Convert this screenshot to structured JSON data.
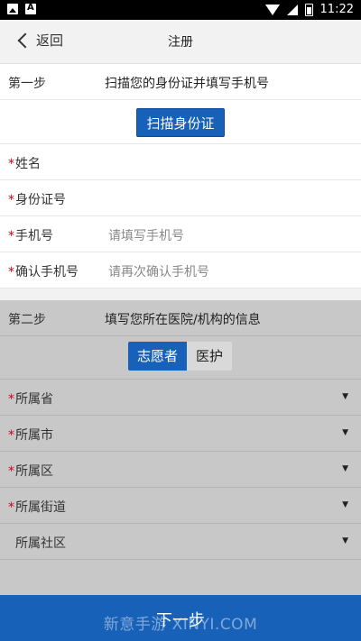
{
  "statusbar": {
    "time": "11:22"
  },
  "nav": {
    "back_label": "返回",
    "title": "注册"
  },
  "step1": {
    "step_label": "第一步",
    "description": "扫描您的身份证并填写手机号",
    "scan_button": "扫描身份证",
    "fields": [
      {
        "label": "姓名",
        "required": "*",
        "value": ""
      },
      {
        "label": "身份证号",
        "required": "*",
        "value": ""
      },
      {
        "label": "手机号",
        "required": "*",
        "placeholder": "请填写手机号"
      },
      {
        "label": "确认手机号",
        "required": "*",
        "placeholder": "请再次确认手机号"
      }
    ]
  },
  "step2": {
    "step_label": "第二步",
    "description": "填写您所在医院/机构的信息",
    "segment": {
      "options": [
        "志愿者",
        "医护"
      ],
      "selected": "志愿者"
    },
    "selects": [
      {
        "label": "所属省",
        "required": "*"
      },
      {
        "label": "所属市",
        "required": "*"
      },
      {
        "label": "所属区",
        "required": "*"
      },
      {
        "label": "所属街道",
        "required": "*"
      },
      {
        "label": "所属社区",
        "required": ""
      }
    ],
    "caret": "▼"
  },
  "footer": {
    "next_label": "下一步",
    "watermark": "新意手游 XINYI.COM"
  },
  "colors": {
    "primary": "#1761b8",
    "required": "#d0021b",
    "section_gray": "#c8c8c8"
  }
}
